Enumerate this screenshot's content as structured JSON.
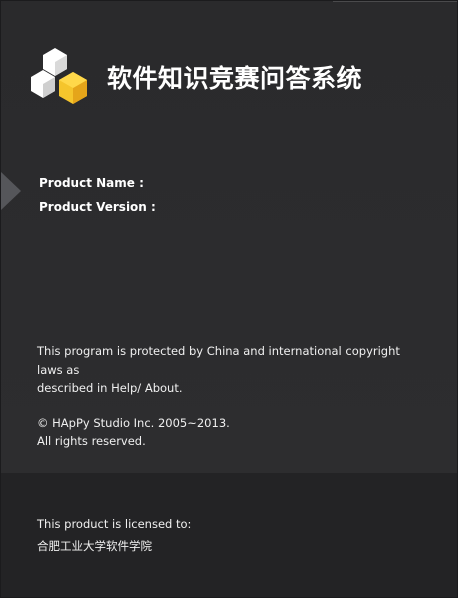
{
  "app": {
    "title": "软件知识竞赛问答系统",
    "logo_icon": "hexagon-cubes-logo",
    "accent_color": "#f5c52c"
  },
  "product": {
    "name_label": "Product Name :",
    "name_value": "",
    "version_label": "Product Version :",
    "version_value": ""
  },
  "legal": {
    "line1": "This  program is protected by China and international copyright laws as",
    "line2": "described in Help/ About.",
    "copyright": "©  HApPy Studio Inc. 2005~2013.",
    "rights": "All rights reserved."
  },
  "license": {
    "label": "This product is licensed to:",
    "licensee": "合肥工业大学软件学院"
  }
}
